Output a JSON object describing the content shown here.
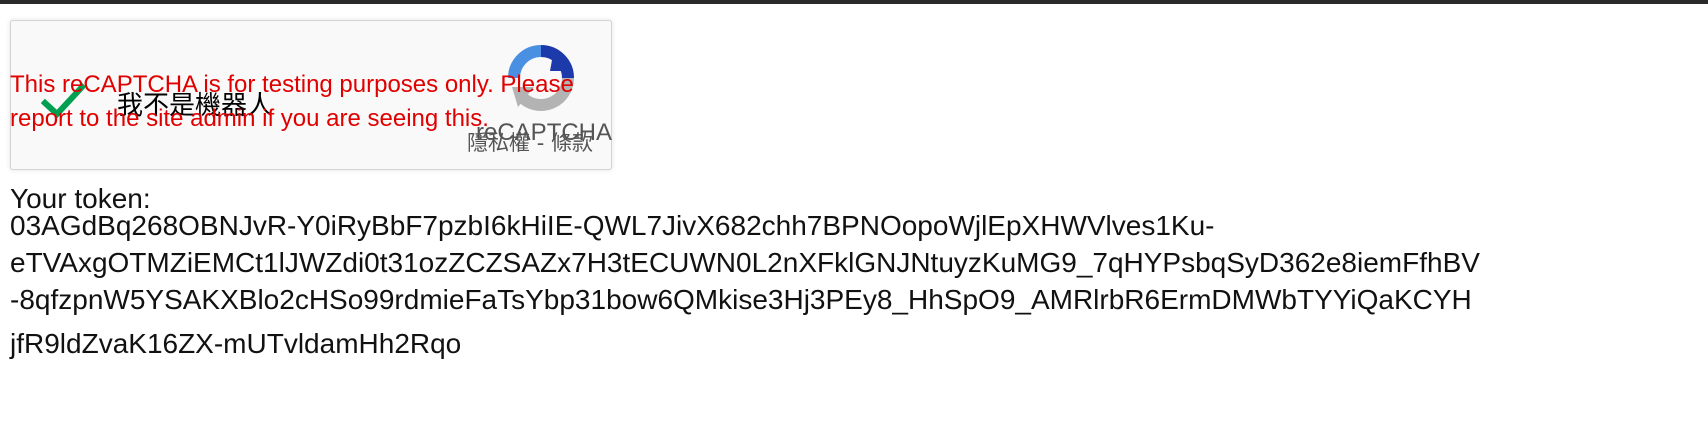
{
  "recaptcha": {
    "checkbox_label": "我不是機器人",
    "logo_text": "reCAPTCHA",
    "privacy_label": "隱私權",
    "terms_separator": " - ",
    "terms_label": "條款",
    "warning": "This reCAPTCHA is for testing purposes only. Please report to the site admin if you are seeing this.",
    "checked": true,
    "colors": {
      "check": "#00a050",
      "logo_blue": "#1c3aa9",
      "logo_light_blue": "#4a90e2",
      "logo_grey": "#b3b3b3",
      "warning": "#e00000"
    }
  },
  "token": {
    "label": "Your token:",
    "lines": [
      "03AGdBq268OBNJvR-Y0iRyBbF7pzbI6kHiIE-QWL7JivX682chh7BPNOopoWjlEpXHWVlves1Ku-",
      "eTVAxgOTMZiEMCt1lJWZdi0t31ozZCZSAZx7H3tECUWN0L2nXFklGNJNtuyzKuMG9_7qHYPsbqSyD362e8iemFfhBV",
      "-8qfzpnW5YSAKXBlo2cHSo99rdmieFaTsYbp31bow6QMkise3Hj3PEy8_HhSpO9_AMRlrbR6ErmDMWbTYYiQaKCYH",
      "jfR9ldZvaK16ZX-mUTvldamHh2Rqo"
    ]
  }
}
